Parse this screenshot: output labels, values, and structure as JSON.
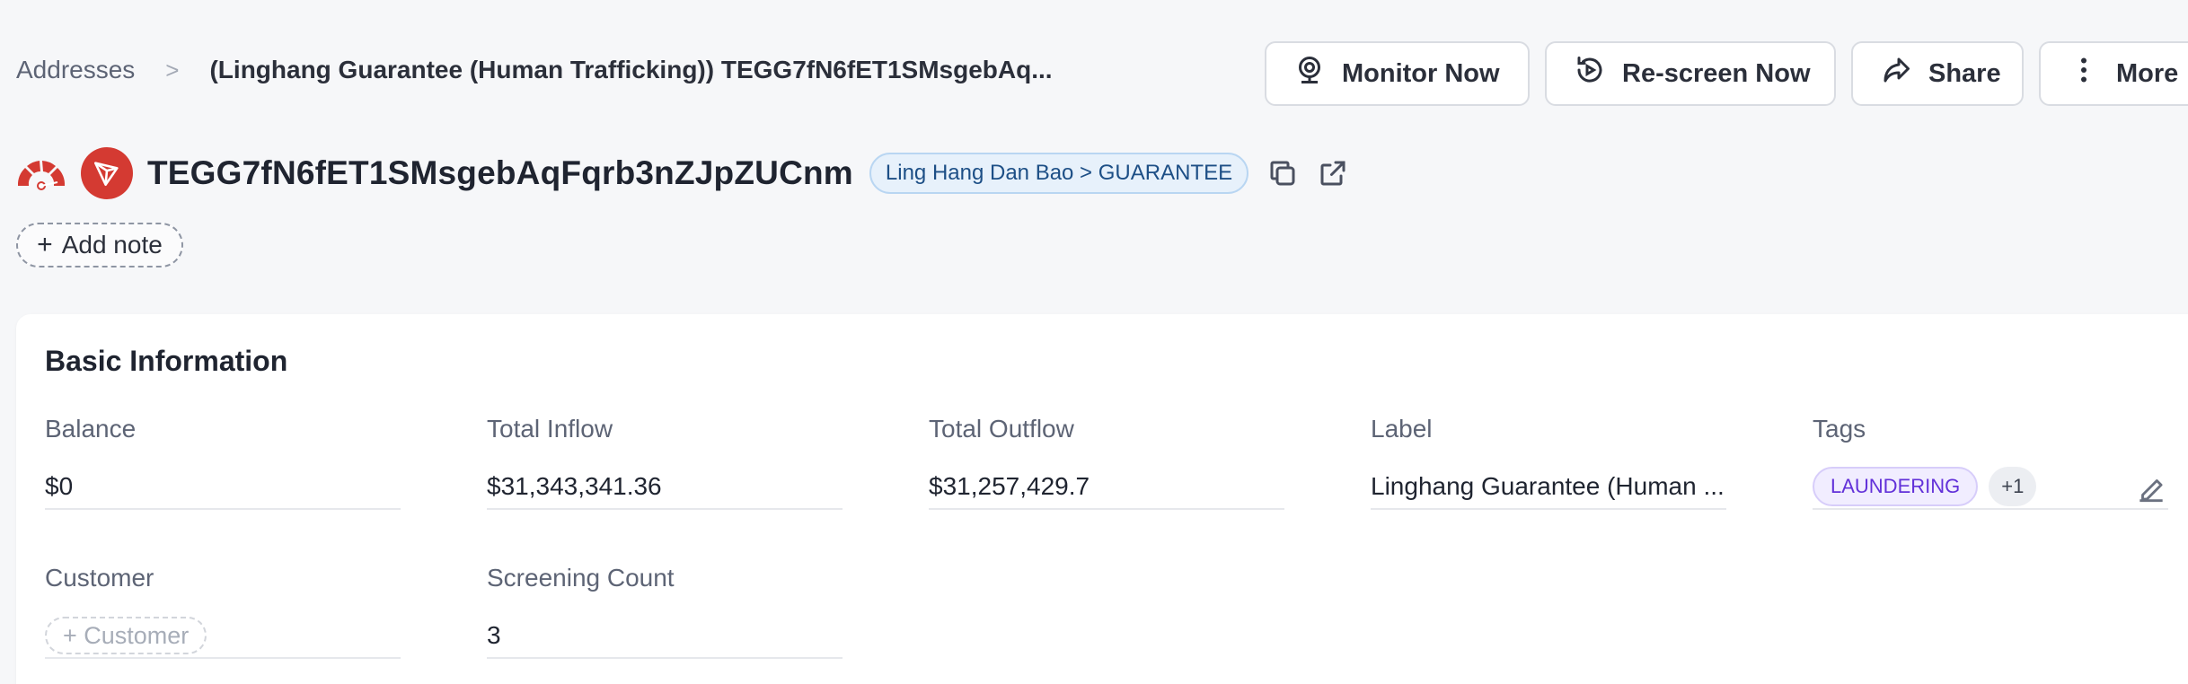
{
  "breadcrumb": {
    "root": "Addresses",
    "separator": ">",
    "current": "(Linghang Guarantee (Human Trafficking)) TEGG7fN6fET1SMsgebAq..."
  },
  "actions": {
    "monitor": "Monitor Now",
    "rescreen": "Re-screen Now",
    "share": "Share",
    "more": "More"
  },
  "address": {
    "value": "TEGG7fN6fET1SMsgebAqFqrb3nZJpZUCnm",
    "entity": "Ling Hang Dan Bao > GUARANTEE",
    "risk_color": "#d43a32",
    "chain_icon": "tron-icon"
  },
  "add_note": {
    "plus": "+",
    "label": "Add note"
  },
  "basic_info": {
    "title": "Basic Information",
    "balance": {
      "label": "Balance",
      "value": "$0"
    },
    "total_inflow": {
      "label": "Total Inflow",
      "value": "$31,343,341.36"
    },
    "total_outflow": {
      "label": "Total Outflow",
      "value": "$31,257,429.7"
    },
    "label": {
      "label": "Label",
      "value": "Linghang Guarantee (Human ..."
    },
    "tags": {
      "label": "Tags",
      "primary": "LAUNDERING",
      "more": "+1"
    },
    "customer": {
      "label": "Customer",
      "placeholder": "+ Customer"
    },
    "screening_count": {
      "label": "Screening Count",
      "value": "3"
    }
  }
}
